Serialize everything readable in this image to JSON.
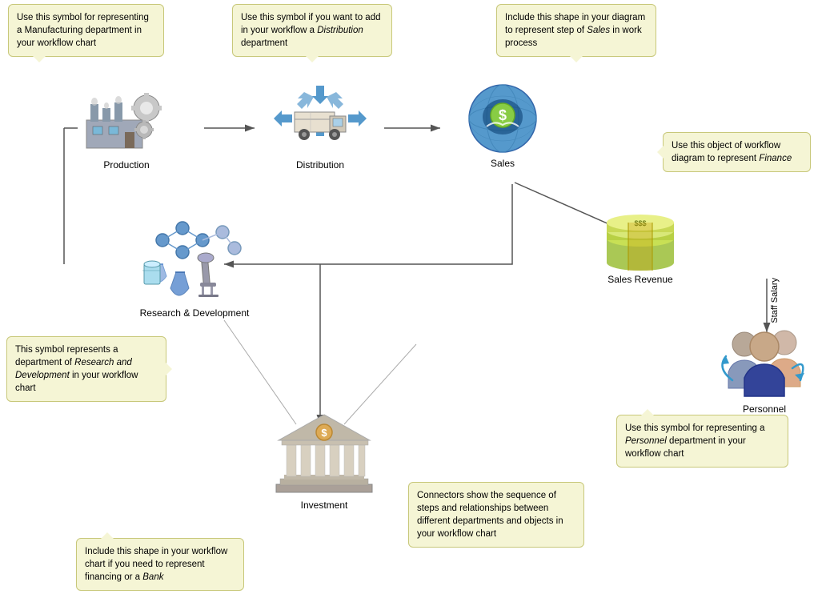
{
  "tooltips": {
    "manufacturing": "Use this symbol for representing a Manufacturing department in your workflow chart",
    "distribution": "Use this symbol if you want to add in your workflow a Distribution department",
    "sales": "Include this shape in your diagram to represent step of Sales in work process",
    "finance": "Use this object of workflow diagram to represent Finance",
    "rd": "This symbol represents a department of Research and Development in your workflow chart",
    "personnel": "Use this symbol for representing a Personnel department in your workflow chart",
    "investment_tooltip": "Include this shape in your workflow chart if you need to represent financing or a Bank",
    "connectors": "Connectors show the sequence of steps and relationships between different departments and objects in your workflow chart"
  },
  "nodes": {
    "production": "Production",
    "distribution": "Distribution",
    "sales": "Sales",
    "sales_revenue": "Sales Revenue",
    "rd": "Research & Development",
    "personnel": "Personnel",
    "investment": "Investment",
    "staff_salary": "Staff Salary"
  }
}
